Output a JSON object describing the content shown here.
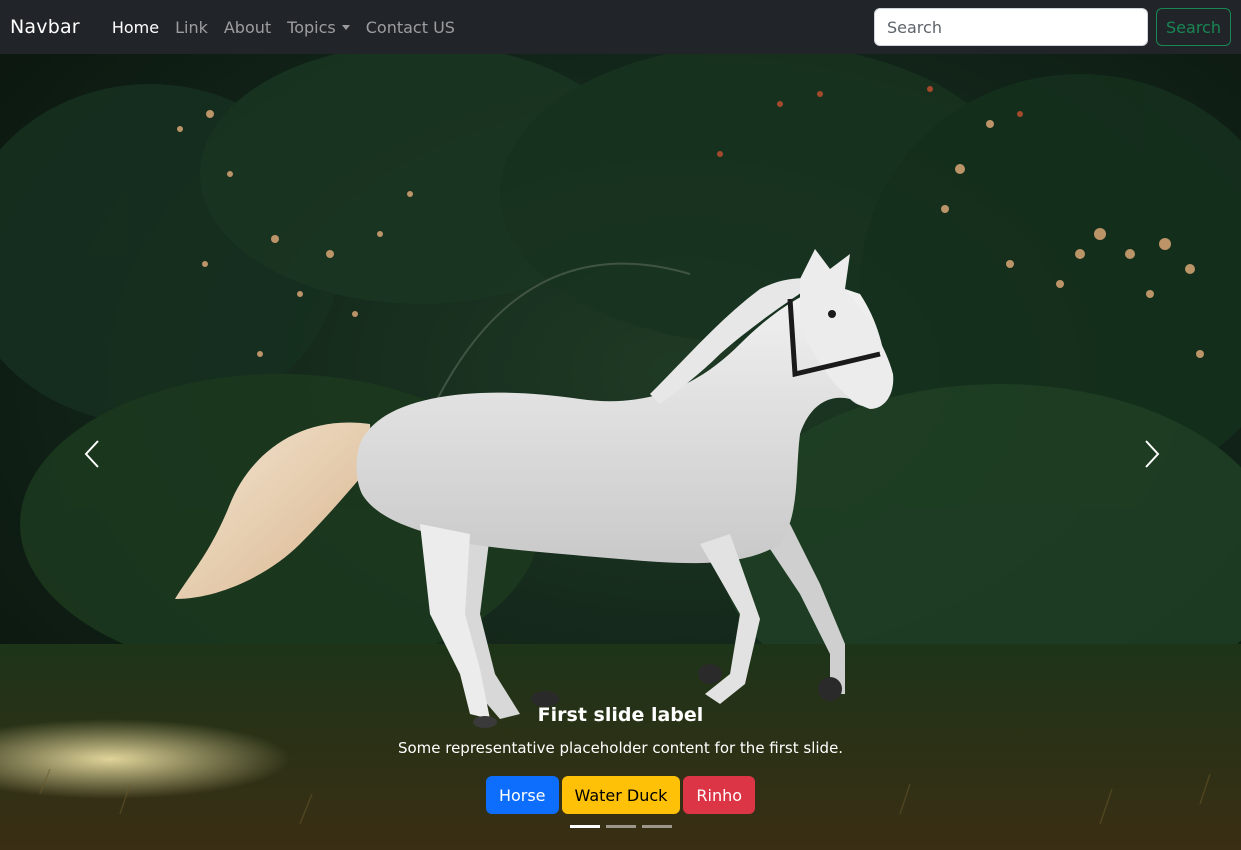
{
  "navbar": {
    "brand": "Navbar",
    "links": [
      {
        "label": "Home",
        "active": true
      },
      {
        "label": "Link",
        "active": false
      },
      {
        "label": "About",
        "active": false
      },
      {
        "label": "Topics",
        "active": false,
        "dropdown": true
      },
      {
        "label": "Contact US",
        "active": false
      }
    ],
    "search": {
      "placeholder": "Search",
      "value": "",
      "button_label": "Search"
    }
  },
  "carousel": {
    "active_slide": 1,
    "slide_count": 3,
    "image_subject": "white horse galloping in front of dark green foliage",
    "caption": {
      "title": "First slide label",
      "text": "Some representative placeholder content for the first slide."
    },
    "buttons": [
      {
        "label": "Horse",
        "color": "#0d6efd"
      },
      {
        "label": "Water Duck",
        "color": "#ffc107"
      },
      {
        "label": "Rinho",
        "color": "#dc3545"
      }
    ],
    "controls": {
      "prev_icon": "chevron-left-icon",
      "next_icon": "chevron-right-icon"
    }
  },
  "colors": {
    "navbar_bg": "#212529",
    "search_outline": "#198754"
  }
}
